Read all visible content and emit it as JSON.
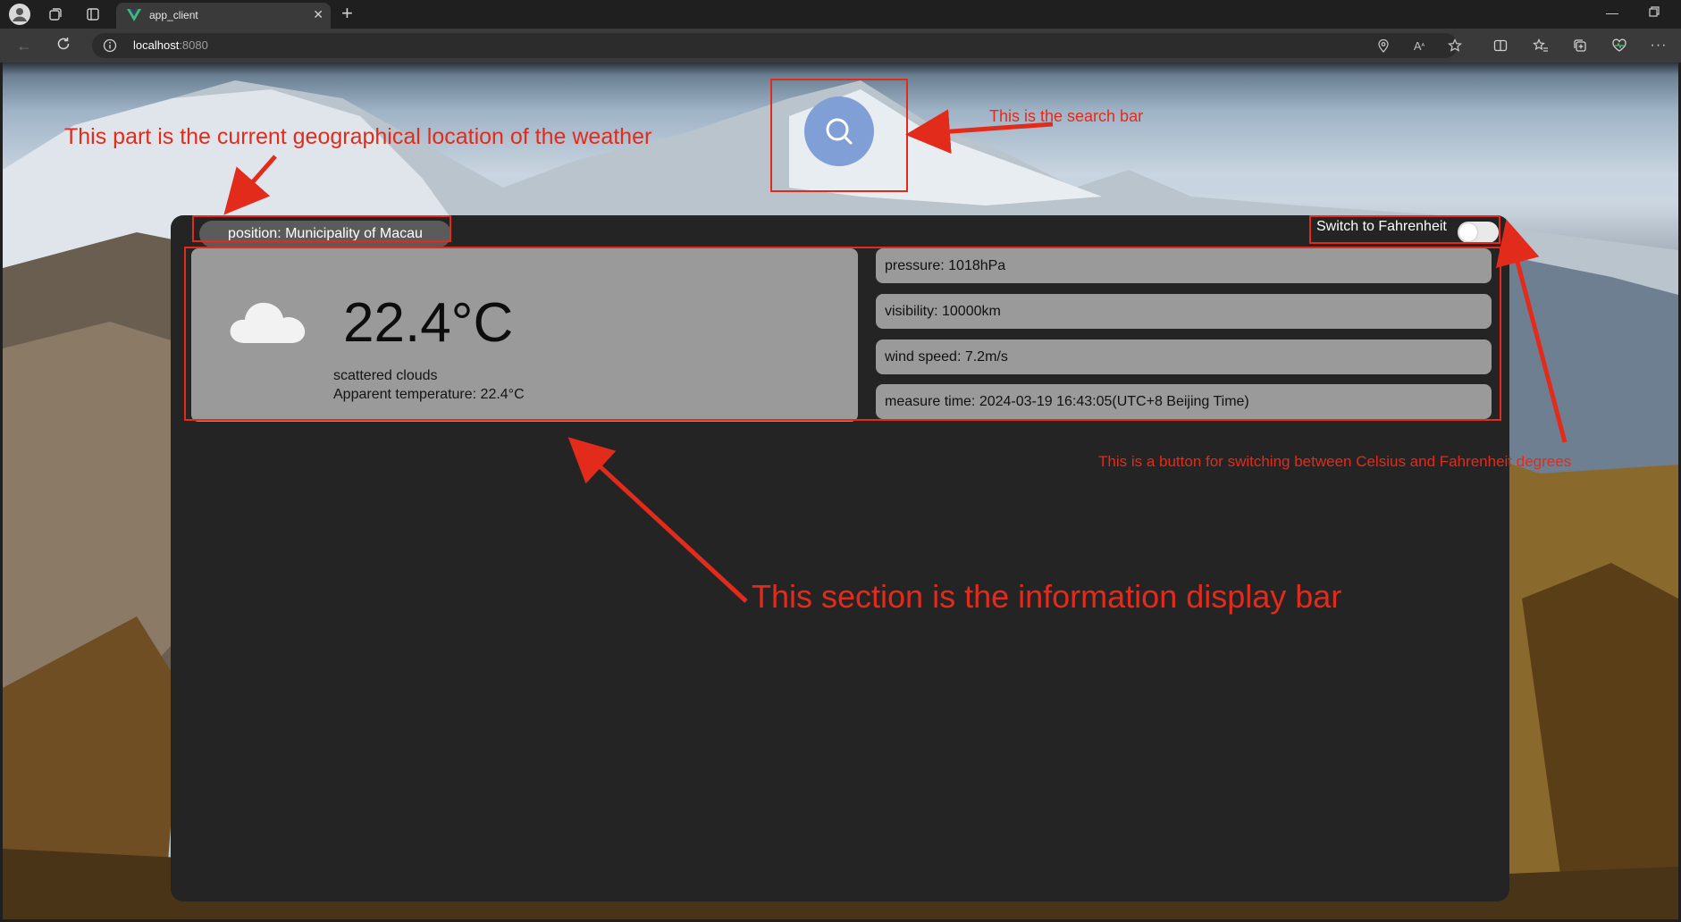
{
  "browser": {
    "tab_title": "app_client",
    "url_host": "localhost",
    "url_port": ":8080",
    "icons": [
      "profile-icon",
      "workspaces-icon",
      "tab-actions-icon",
      "vue-logo-icon",
      "close-icon",
      "plus-icon",
      "back-icon",
      "reload-icon",
      "info-icon",
      "location-icon",
      "read-aloud-icon",
      "favorite-star-icon",
      "split-screen-icon",
      "favorites-icon",
      "collections-icon",
      "performance-icon",
      "more-icon",
      "minimize-icon",
      "restore-icon"
    ]
  },
  "app": {
    "position_label": "position: Municipality of Macau",
    "fahrenheit_toggle_label": "Switch to Fahrenheit",
    "temperature": "22.4°C",
    "description": "scattered clouds",
    "apparent_temperature": "Apparent temperature: 22.4°C",
    "details": [
      "pressure: 1018hPa",
      "visibility: 10000km",
      "wind speed: 7.2m/s",
      "measure time: 2024-03-19 16:43:05(UTC+8 Beijing Time)"
    ],
    "toggle_on": false,
    "accent_color": "#7f9fd6"
  },
  "annotations": {
    "location": "This part is the current geographical location of the weather",
    "search": "This is the search bar",
    "toggle": "This is a button for switching between Celsius and Fahrenheit degrees",
    "info": "This section is the information display bar",
    "color": "#e32b1b"
  }
}
